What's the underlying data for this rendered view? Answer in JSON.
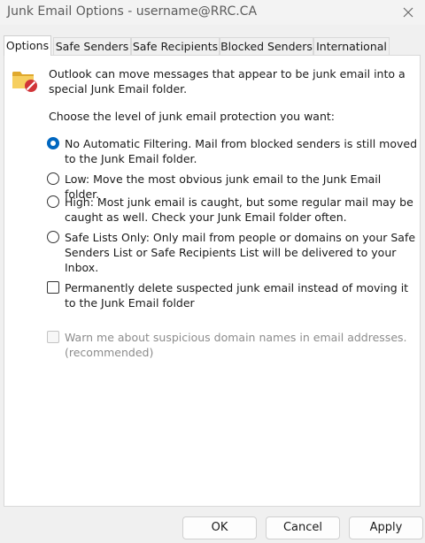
{
  "window": {
    "title": "Junk Email Options - username@RRC.CA"
  },
  "tabs": [
    {
      "label": "Options"
    },
    {
      "label": "Safe Senders"
    },
    {
      "label": "Safe Recipients"
    },
    {
      "label": "Blocked Senders"
    },
    {
      "label": "International"
    }
  ],
  "options_panel": {
    "intro": "Outlook can move messages that appear to be junk email into a special Junk Email folder.",
    "choose_label": "Choose the level of junk email protection you want:",
    "radios": [
      {
        "label": "No Automatic Filtering. Mail from blocked senders is still moved to the Junk Email folder.",
        "selected": true
      },
      {
        "label": "Low: Move the most obvious junk email to the Junk Email folder.",
        "selected": false
      },
      {
        "label": "High: Most junk email is caught, but some regular mail may be caught as well. Check your Junk Email folder often.",
        "selected": false
      },
      {
        "label": "Safe Lists Only: Only mail from people or domains on your Safe Senders List or Safe Recipients List will be delivered to your Inbox.",
        "selected": false
      }
    ],
    "permanent_delete": {
      "label": "Permanently delete suspected junk email instead of moving it to the Junk Email folder",
      "checked": false
    },
    "warn_suspicious": {
      "label": "Warn me about suspicious domain names in email addresses. (recommended)",
      "checked": false,
      "enabled": false
    }
  },
  "buttons": {
    "ok": "OK",
    "cancel": "Cancel",
    "apply": "Apply"
  },
  "colors": {
    "accent": "#0067c0",
    "warning_badge": "#d13438",
    "folder": "#f2c14e"
  }
}
